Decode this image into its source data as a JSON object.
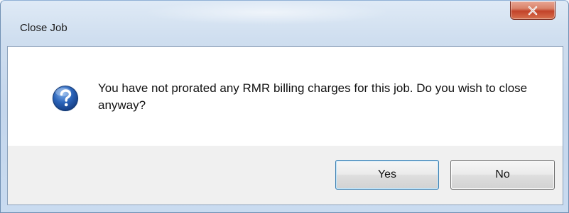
{
  "window": {
    "title": "Close Job"
  },
  "dialog": {
    "message": "You have not prorated any RMR billing charges for this job. Do you wish to close anyway?",
    "icon": "question-icon"
  },
  "buttons": {
    "yes_label": "Yes",
    "no_label": "No"
  },
  "titlebar": {
    "close_icon": "close-icon"
  },
  "colors": {
    "close_button": "#c3432a",
    "icon_blue": "#1f4f9a",
    "footer": "#f0f0f0"
  }
}
